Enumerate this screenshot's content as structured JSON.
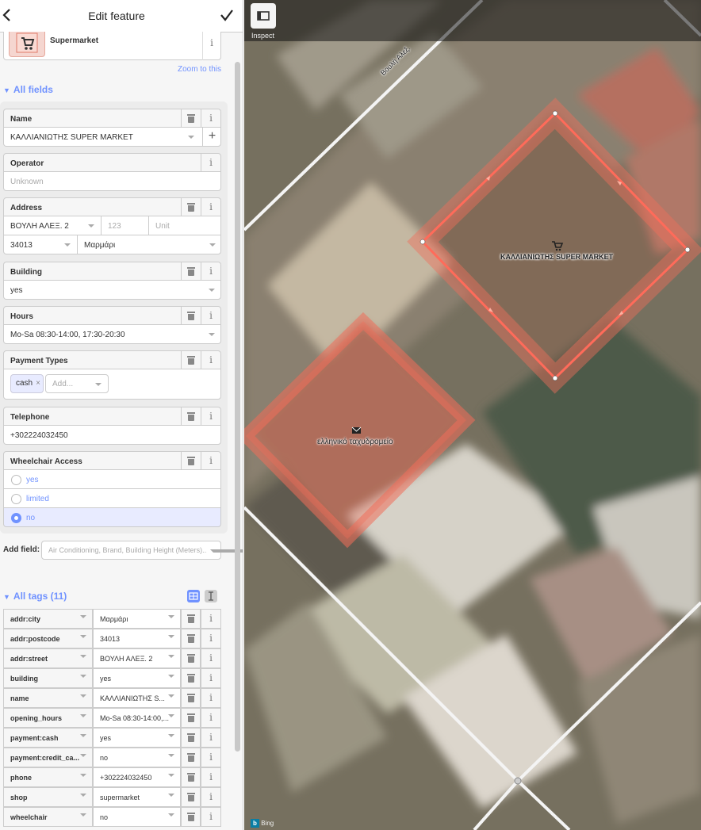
{
  "header": {
    "title": "Edit feature"
  },
  "preset": {
    "name": "Supermarket"
  },
  "zoom_link": "Zoom to this",
  "all_fields_title": "All fields",
  "fields": {
    "name": {
      "label": "Name",
      "value": "ΚΑΛΛΙΑΝΙΩΤΗΣ SUPER MARKET"
    },
    "operator": {
      "label": "Operator",
      "placeholder": "Unknown"
    },
    "address": {
      "label": "Address",
      "street": "ΒΟΥΛΗ ΑΛΕΞ. 2",
      "housenumber_placeholder": "123",
      "unit_placeholder": "Unit",
      "postcode": "34013",
      "city": "Μαρμάρι"
    },
    "building": {
      "label": "Building",
      "value": "yes"
    },
    "hours": {
      "label": "Hours",
      "value": "Mo-Sa 08:30-14:00, 17:30-20:30"
    },
    "payment": {
      "label": "Payment Types",
      "chip": "cash",
      "add_placeholder": "Add..."
    },
    "telephone": {
      "label": "Telephone",
      "value": "+302224032450"
    },
    "wheelchair": {
      "label": "Wheelchair Access",
      "options": [
        "yes",
        "limited",
        "no"
      ],
      "selected": "no"
    }
  },
  "add_field": {
    "label": "Add field:",
    "placeholder": "Air Conditioning, Brand, Building Height (Meters)..."
  },
  "all_tags_title": "All tags (11)",
  "tags": [
    {
      "key": "addr:city",
      "value": "Μαρμάρι"
    },
    {
      "key": "addr:postcode",
      "value": "34013"
    },
    {
      "key": "addr:street",
      "value": "ΒΟΥΛΗ ΑΛΕΞ. 2"
    },
    {
      "key": "building",
      "value": "yes"
    },
    {
      "key": "name",
      "value": "ΚΑΛΛΙΑΝΙΩΤΗΣ S..."
    },
    {
      "key": "opening_hours",
      "value": "Mo-Sa 08:30-14:00,..."
    },
    {
      "key": "payment:cash",
      "value": "yes"
    },
    {
      "key": "payment:credit_ca...",
      "value": "no"
    },
    {
      "key": "phone",
      "value": "+302224032450"
    },
    {
      "key": "shop",
      "value": "supermarket"
    },
    {
      "key": "wheelchair",
      "value": "no"
    }
  ],
  "map": {
    "inspect_label": "Inspect",
    "street_label": "Βουλή Αλεξ.",
    "supermarket_label": "ΚΑΛΛΙΑΝΙΩΤΗΣ SUPER MARKET",
    "post_label": "ελληνικό ταχυδρομείο",
    "imagery_credit": "Bing"
  },
  "colors": {
    "accent": "#7092ff",
    "selection": "#ff6b5a"
  }
}
